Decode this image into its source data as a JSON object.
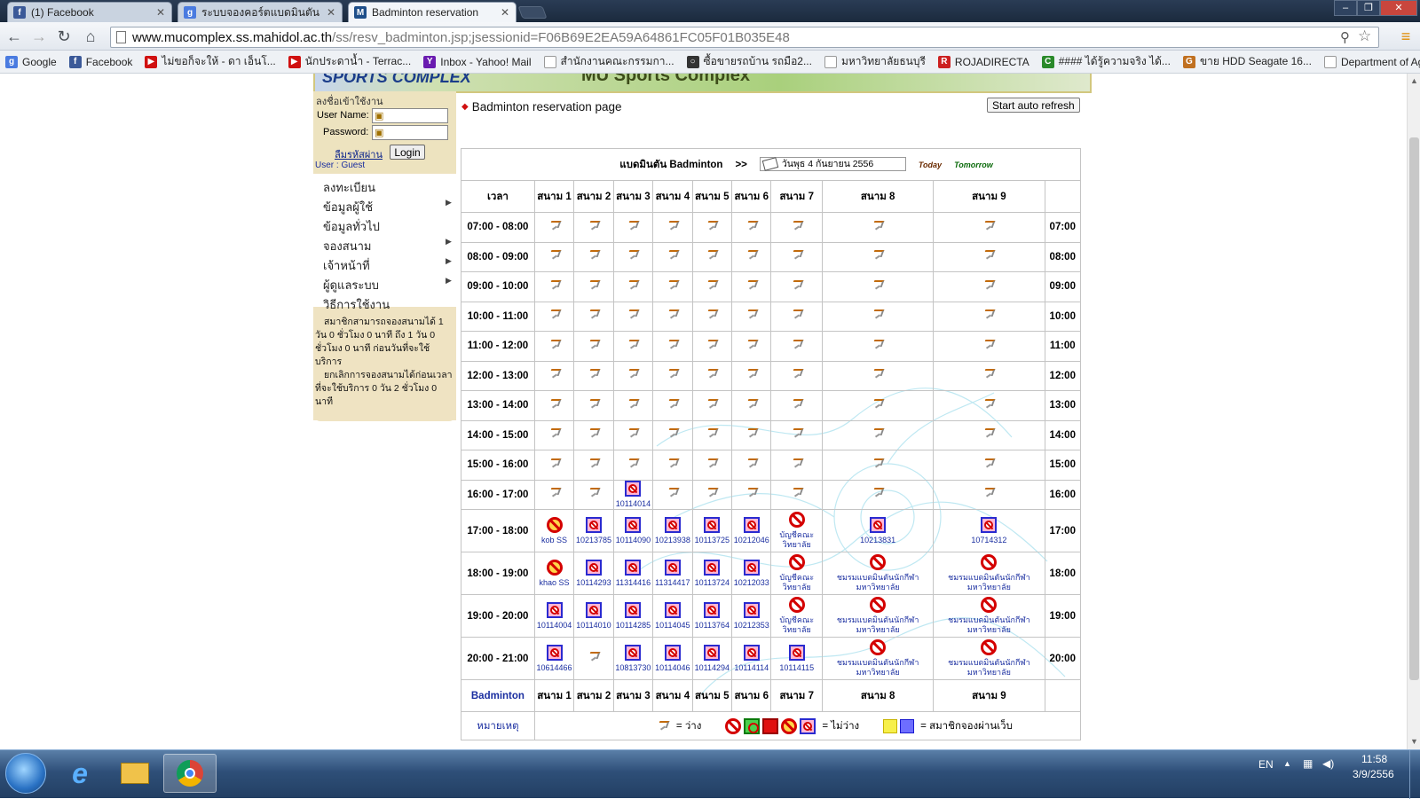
{
  "browser": {
    "tabs": [
      {
        "title": "(1) Facebook",
        "fav": "f",
        "color": "#3b5998"
      },
      {
        "title": "ระบบจองคอร์ตแบดมินตัน - C",
        "fav": "g",
        "color": "#4a7be0"
      },
      {
        "title": "Badminton reservation",
        "fav": "M",
        "color": "#1f4f8a"
      }
    ],
    "url_host": "www.mucomplex.ss.mahidol.ac.th",
    "url_path": "/ss/resv_badminton.jsp;jsessionid=F06B69E2EA59A64861FC05F01B035E48",
    "bookmarks": [
      {
        "label": "Google",
        "fav": "g",
        "color": "#4a7be0"
      },
      {
        "label": "Facebook",
        "fav": "f",
        "color": "#3b5998"
      },
      {
        "label": "ไม่ขอก็จะให้ - ดา เอ็นโ...",
        "fav": "▶",
        "color": "#d01010"
      },
      {
        "label": "นักประดาน้ำ - Terrac...",
        "fav": "▶",
        "color": "#d01010"
      },
      {
        "label": "Inbox - Yahoo! Mail",
        "fav": "Y",
        "color": "#6a1bb0"
      },
      {
        "label": "สำนักงานคณะกรรมกา...",
        "fav": "",
        "color": "#ffffff"
      },
      {
        "label": "ซื้อขายรถบ้าน รถมือ2...",
        "fav": "○",
        "color": "#333333"
      },
      {
        "label": "มหาวิทยาลัยธนบุรี",
        "fav": "",
        "color": "#ffffff"
      },
      {
        "label": "ROJADIRECTA",
        "fav": "R",
        "color": "#cc2020"
      },
      {
        "label": "#### ได้รู้ความจริง ได้...",
        "fav": "C",
        "color": "#2a8a2a"
      },
      {
        "label": "ขาย HDD Seagate 16...",
        "fav": "G",
        "color": "#c07020"
      },
      {
        "label": "Department of Agric...",
        "fav": "",
        "color": "#ffffff"
      }
    ]
  },
  "banner": {
    "left": "SPORTS COMPLEX",
    "right": "MU Sports Complex"
  },
  "login": {
    "caption": "ลงชื่อเข้าใช้งาน",
    "username_label": "User Name:",
    "password_label": "Password:",
    "forgot": "ลืมรหัสผ่าน",
    "login_btn": "Login",
    "user_status": "User : Guest"
  },
  "menu": [
    {
      "label": "ลงทะเบียน",
      "arrow": ""
    },
    {
      "label": "ข้อมูลผู้ใช้",
      "arrow": "▶"
    },
    {
      "label": "ข้อมูลทั่วไป",
      "arrow": ""
    },
    {
      "label": "จองสนาม",
      "arrow": "▶"
    },
    {
      "label": "เจ้าหน้าที่",
      "arrow": "▶"
    },
    {
      "label": "ผู้ดูแลระบบ",
      "arrow": "▶"
    },
    {
      "label": "วิธีการใช้งาน",
      "arrow": ""
    }
  ],
  "notes": [
    "สมาชิกสามารถจองสนามได้ 1 วัน 0 ชั่วโมง 0 นาที ถึง 1 วัน 0 ชั่วโมง 0 นาที ก่อนวันที่จะใช้บริการ",
    "ยกเลิกการจองสนามได้ก่อนเวลาที่จะใช้บริการ 0 วัน 2 ชั่วโมง 0 นาที"
  ],
  "page": {
    "title": "Badminton reservation page",
    "refresh_btn": "Start auto refresh",
    "sport_label": "แบดมินตัน Badminton",
    "arrow": ">>",
    "date": "วันพุธ  4 กันยายน 2556",
    "today": "Today",
    "tomorrow": "Tomorrow"
  },
  "table": {
    "time_header": "เวลา",
    "footer_label": "Badminton",
    "courts": [
      "สนาม 1",
      "สนาม 2",
      "สนาม 3",
      "สนาม 4",
      "สนาม 5",
      "สนาม 6",
      "สนาม 7",
      "สนาม 8",
      "สนาม 9"
    ],
    "rows": [
      {
        "time": "07:00 - 08:00",
        "right": "07:00",
        "cells": [
          {
            "t": "free"
          },
          {
            "t": "free"
          },
          {
            "t": "free"
          },
          {
            "t": "free"
          },
          {
            "t": "free"
          },
          {
            "t": "free"
          },
          {
            "t": "free"
          },
          {
            "t": "free"
          },
          {
            "t": "free"
          }
        ]
      },
      {
        "time": "08:00 - 09:00",
        "right": "08:00",
        "cells": [
          {
            "t": "free"
          },
          {
            "t": "free"
          },
          {
            "t": "free"
          },
          {
            "t": "free"
          },
          {
            "t": "free"
          },
          {
            "t": "free"
          },
          {
            "t": "free"
          },
          {
            "t": "free"
          },
          {
            "t": "free"
          }
        ]
      },
      {
        "time": "09:00 - 10:00",
        "right": "09:00",
        "cells": [
          {
            "t": "free"
          },
          {
            "t": "free"
          },
          {
            "t": "free"
          },
          {
            "t": "free"
          },
          {
            "t": "free"
          },
          {
            "t": "free"
          },
          {
            "t": "free"
          },
          {
            "t": "free"
          },
          {
            "t": "free"
          }
        ]
      },
      {
        "time": "10:00 - 11:00",
        "right": "10:00",
        "cells": [
          {
            "t": "free"
          },
          {
            "t": "free"
          },
          {
            "t": "free"
          },
          {
            "t": "free"
          },
          {
            "t": "free"
          },
          {
            "t": "free"
          },
          {
            "t": "free"
          },
          {
            "t": "free"
          },
          {
            "t": "free"
          }
        ]
      },
      {
        "time": "11:00 - 12:00",
        "right": "11:00",
        "cells": [
          {
            "t": "free"
          },
          {
            "t": "free"
          },
          {
            "t": "free"
          },
          {
            "t": "free"
          },
          {
            "t": "free"
          },
          {
            "t": "free"
          },
          {
            "t": "free"
          },
          {
            "t": "free"
          },
          {
            "t": "free"
          }
        ]
      },
      {
        "time": "12:00 - 13:00",
        "right": "12:00",
        "cells": [
          {
            "t": "free"
          },
          {
            "t": "free"
          },
          {
            "t": "free"
          },
          {
            "t": "free"
          },
          {
            "t": "free"
          },
          {
            "t": "free"
          },
          {
            "t": "free"
          },
          {
            "t": "free"
          },
          {
            "t": "free"
          }
        ]
      },
      {
        "time": "13:00 - 14:00",
        "right": "13:00",
        "cells": [
          {
            "t": "free"
          },
          {
            "t": "free"
          },
          {
            "t": "free"
          },
          {
            "t": "free"
          },
          {
            "t": "free"
          },
          {
            "t": "free"
          },
          {
            "t": "free"
          },
          {
            "t": "free"
          },
          {
            "t": "free"
          }
        ]
      },
      {
        "time": "14:00 - 15:00",
        "right": "14:00",
        "cells": [
          {
            "t": "free"
          },
          {
            "t": "free"
          },
          {
            "t": "free"
          },
          {
            "t": "free"
          },
          {
            "t": "free"
          },
          {
            "t": "free"
          },
          {
            "t": "free"
          },
          {
            "t": "free"
          },
          {
            "t": "free"
          }
        ]
      },
      {
        "time": "15:00 - 16:00",
        "right": "15:00",
        "cells": [
          {
            "t": "free"
          },
          {
            "t": "free"
          },
          {
            "t": "free"
          },
          {
            "t": "free"
          },
          {
            "t": "free"
          },
          {
            "t": "free"
          },
          {
            "t": "free"
          },
          {
            "t": "free"
          },
          {
            "t": "free"
          }
        ]
      },
      {
        "time": "16:00 - 17:00",
        "right": "16:00",
        "cells": [
          {
            "t": "free"
          },
          {
            "t": "free"
          },
          {
            "t": "booked",
            "id": "10114014"
          },
          {
            "t": "free"
          },
          {
            "t": "free"
          },
          {
            "t": "free"
          },
          {
            "t": "free"
          },
          {
            "t": "free"
          },
          {
            "t": "free"
          }
        ]
      },
      {
        "time": "17:00 - 18:00",
        "right": "17:00",
        "cells": [
          {
            "t": "staff",
            "id": "kob SS"
          },
          {
            "t": "booked",
            "id": "10213785"
          },
          {
            "t": "booked",
            "id": "10114090"
          },
          {
            "t": "booked",
            "id": "10213938"
          },
          {
            "t": "booked",
            "id": "10113725"
          },
          {
            "t": "booked",
            "id": "10212046"
          },
          {
            "t": "closed",
            "id": "บัญชีคณะ",
            "id2": "วิทยาลัย"
          },
          {
            "t": "booked",
            "id": "10213831"
          },
          {
            "t": "booked",
            "id": "10714312"
          }
        ]
      },
      {
        "time": "18:00 - 19:00",
        "right": "18:00",
        "cells": [
          {
            "t": "staff",
            "id": "khao SS"
          },
          {
            "t": "booked",
            "id": "10114293"
          },
          {
            "t": "booked",
            "id": "11314416"
          },
          {
            "t": "booked",
            "id": "11314417"
          },
          {
            "t": "booked",
            "id": "10113724"
          },
          {
            "t": "booked",
            "id": "10212033"
          },
          {
            "t": "closed",
            "id": "บัญชีคณะ",
            "id2": "วิทยาลัย"
          },
          {
            "t": "closed",
            "id": "ชมรมแบดมินตันนักกีฬา",
            "id2": "มหาวิทยาลัย"
          },
          {
            "t": "closed",
            "id": "ชมรมแบดมินตันนักกีฬา",
            "id2": "มหาวิทยาลัย"
          }
        ]
      },
      {
        "time": "19:00 - 20:00",
        "right": "19:00",
        "cells": [
          {
            "t": "booked",
            "id": "10114004"
          },
          {
            "t": "booked",
            "id": "10114010"
          },
          {
            "t": "booked",
            "id": "10114285"
          },
          {
            "t": "booked",
            "id": "10114045"
          },
          {
            "t": "booked",
            "id": "10113764"
          },
          {
            "t": "booked",
            "id": "10212353"
          },
          {
            "t": "closed",
            "id": "บัญชีคณะ",
            "id2": "วิทยาลัย"
          },
          {
            "t": "closed",
            "id": "ชมรมแบดมินตันนักกีฬา",
            "id2": "มหาวิทยาลัย"
          },
          {
            "t": "closed",
            "id": "ชมรมแบดมินตันนักกีฬา",
            "id2": "มหาวิทยาลัย"
          }
        ]
      },
      {
        "time": "20:00 - 21:00",
        "right": "20:00",
        "cells": [
          {
            "t": "booked",
            "id": "10614466"
          },
          {
            "t": "free"
          },
          {
            "t": "booked",
            "id": "10813730"
          },
          {
            "t": "booked",
            "id": "10114046"
          },
          {
            "t": "booked",
            "id": "10114294"
          },
          {
            "t": "booked",
            "id": "10114114"
          },
          {
            "t": "booked",
            "id": "10114115"
          },
          {
            "t": "closed",
            "id": "ชมรมแบดมินตันนักกีฬา",
            "id2": "มหาวิทยาลัย"
          },
          {
            "t": "closed",
            "id": "ชมรมแบดมินตันนักกีฬา",
            "id2": "มหาวิทยาลัย"
          }
        ]
      }
    ],
    "legend_label": "หมายเหตุ",
    "legend_free": "= ว่าง",
    "legend_busy": "= ไม่ว่าง",
    "legend_web": "= สมาชิกจองผ่านเว็บ"
  },
  "taskbar": {
    "lang": "EN",
    "time": "11:58",
    "date": "3/9/2556"
  }
}
